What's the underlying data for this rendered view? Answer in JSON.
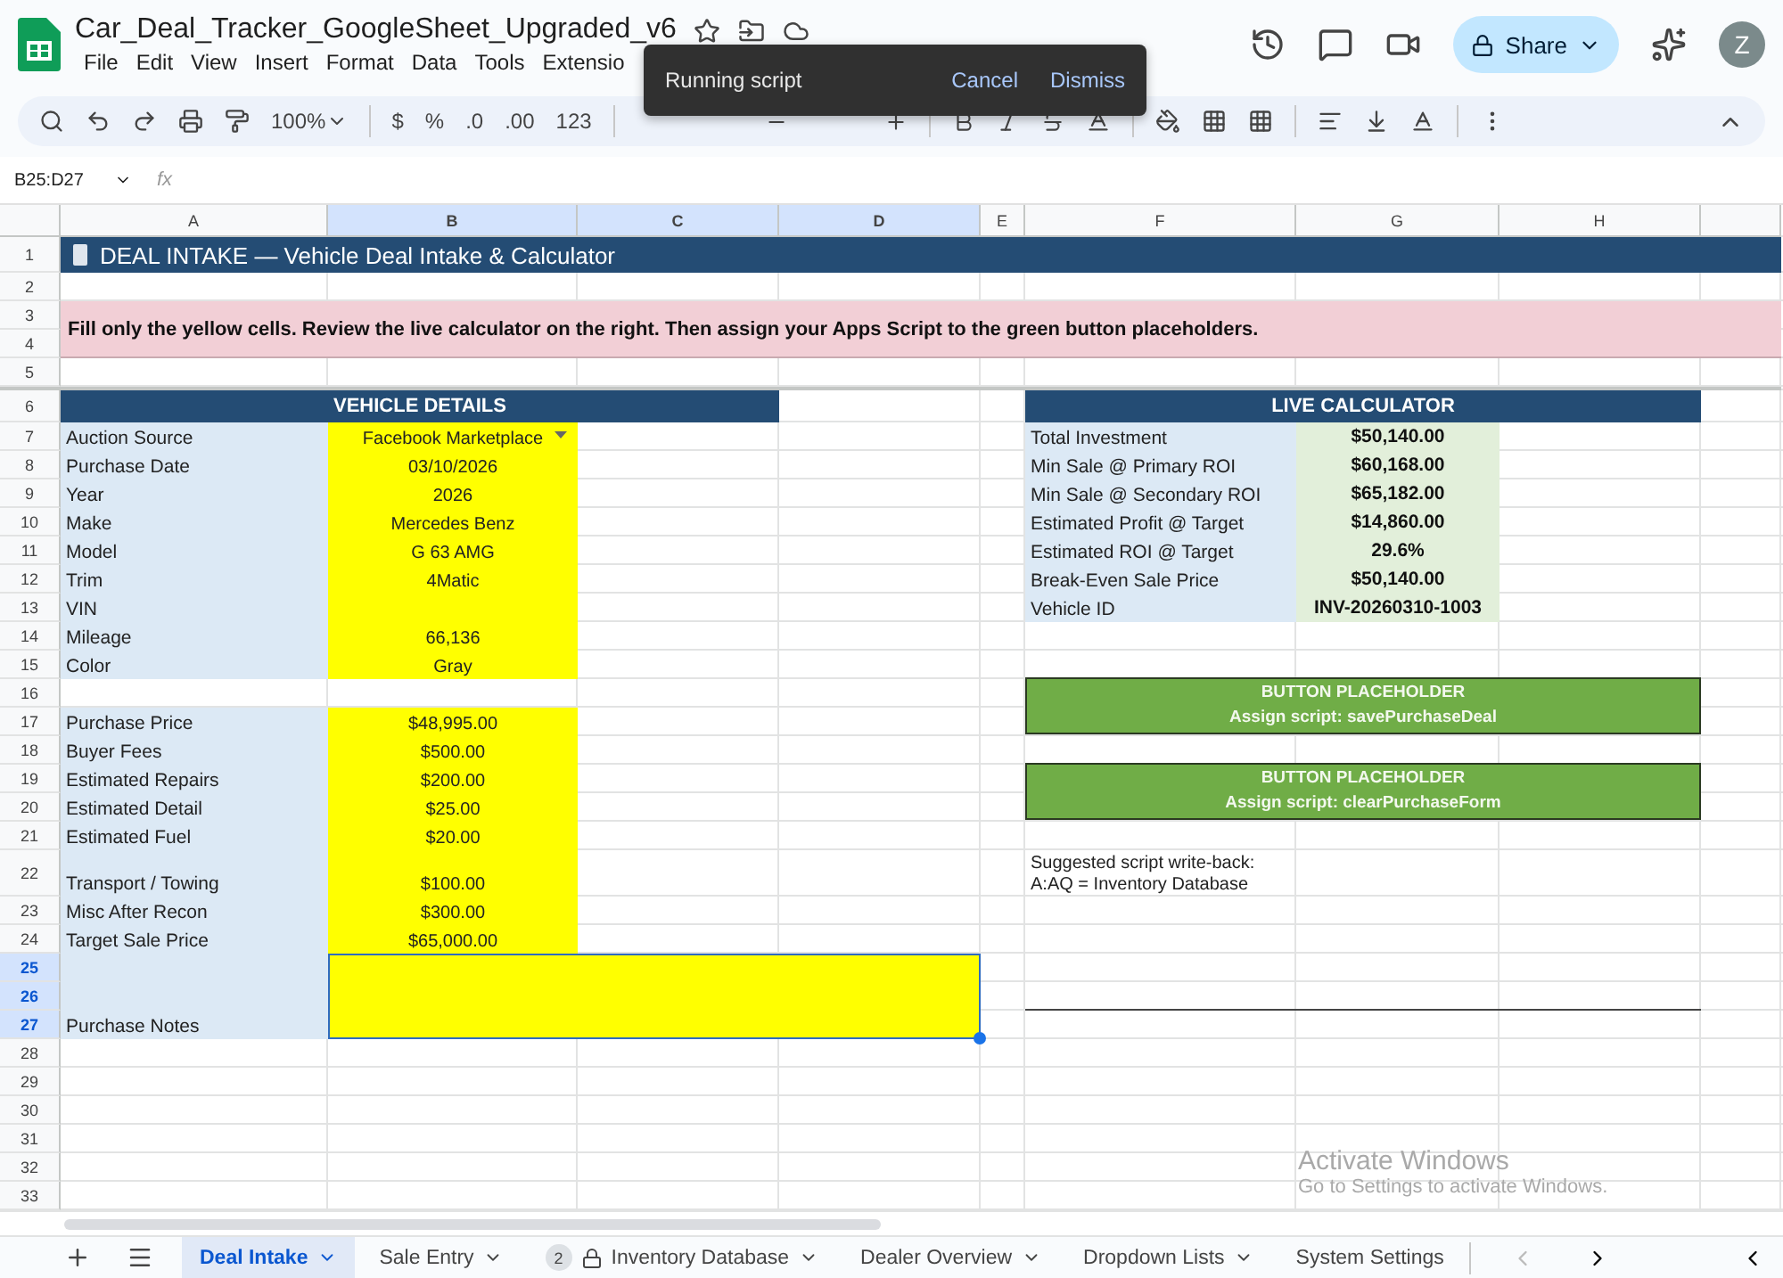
{
  "document": {
    "title": "Car_Deal_Tracker_GoogleSheet_Upgraded_v6",
    "menu": [
      "File",
      "Edit",
      "View",
      "Insert",
      "Format",
      "Data",
      "Tools",
      "Extensio"
    ]
  },
  "toast": {
    "message": "Running script",
    "actions": [
      "Cancel",
      "Dismiss"
    ]
  },
  "header_actions": {
    "share": "Share",
    "avatar": "Z"
  },
  "toolbar": {
    "zoom": "100%",
    "formats": [
      "$",
      "%",
      ".0",
      ".00",
      "123"
    ]
  },
  "formula_bar": {
    "name_box": "B25:D27",
    "fx": "fx"
  },
  "columns": [
    {
      "label": "A",
      "selected": false
    },
    {
      "label": "B",
      "selected": true
    },
    {
      "label": "C",
      "selected": true
    },
    {
      "label": "D",
      "selected": true
    },
    {
      "label": "E",
      "selected": false
    },
    {
      "label": "F",
      "selected": false
    },
    {
      "label": "G",
      "selected": false
    },
    {
      "label": "H",
      "selected": false
    }
  ],
  "rows": [
    {
      "label": "1",
      "selected": false
    },
    {
      "label": "2",
      "selected": false
    },
    {
      "label": "3",
      "selected": false
    },
    {
      "label": "4",
      "selected": false
    },
    {
      "label": "5",
      "selected": false
    },
    {
      "label": "6",
      "selected": false
    },
    {
      "label": "7",
      "selected": false
    },
    {
      "label": "8",
      "selected": false
    },
    {
      "label": "9",
      "selected": false
    },
    {
      "label": "10",
      "selected": false
    },
    {
      "label": "11",
      "selected": false
    },
    {
      "label": "12",
      "selected": false
    },
    {
      "label": "13",
      "selected": false
    },
    {
      "label": "14",
      "selected": false
    },
    {
      "label": "15",
      "selected": false
    },
    {
      "label": "16",
      "selected": false
    },
    {
      "label": "17",
      "selected": false
    },
    {
      "label": "18",
      "selected": false
    },
    {
      "label": "19",
      "selected": false
    },
    {
      "label": "20",
      "selected": false
    },
    {
      "label": "21",
      "selected": false
    },
    {
      "label": "22",
      "selected": false
    },
    {
      "label": "23",
      "selected": false
    },
    {
      "label": "24",
      "selected": false
    },
    {
      "label": "25",
      "selected": true
    },
    {
      "label": "26",
      "selected": true
    },
    {
      "label": "27",
      "selected": true
    },
    {
      "label": "28",
      "selected": false
    },
    {
      "label": "29",
      "selected": false
    },
    {
      "label": "30",
      "selected": false
    },
    {
      "label": "31",
      "selected": false
    },
    {
      "label": "32",
      "selected": false
    },
    {
      "label": "33",
      "selected": false
    }
  ],
  "banner": "DEAL INTAKE — Vehicle Deal Intake & Calculator",
  "instruction": "Fill only the yellow cells. Review the live calculator on the right. Then assign your Apps Script to the green button placeholders.",
  "vehicle_details": {
    "header": "VEHICLE DETAILS",
    "fields": [
      {
        "label": "Auction Source",
        "value": "Facebook Marketplace",
        "kind": "dropdown"
      },
      {
        "label": "Purchase Date",
        "value": "03/10/2026",
        "kind": "text"
      },
      {
        "label": "Year",
        "value": "2026",
        "kind": "text"
      },
      {
        "label": "Make",
        "value": "Mercedes Benz",
        "kind": "text"
      },
      {
        "label": "Model",
        "value": "G 63 AMG",
        "kind": "text"
      },
      {
        "label": "Trim",
        "value": "4Matic",
        "kind": "text"
      },
      {
        "label": "VIN",
        "kind": "text"
      },
      {
        "label": "Mileage",
        "value": "66,136",
        "kind": "text"
      },
      {
        "label": "Color",
        "value": "Gray",
        "kind": "text"
      }
    ]
  },
  "costs": [
    {
      "label": "Purchase Price",
      "value": "$48,995.00"
    },
    {
      "label": "Buyer Fees",
      "value": "$500.00"
    },
    {
      "label": "Estimated Repairs",
      "value": "$200.00"
    },
    {
      "label": "Estimated Detail",
      "value": "$25.00"
    },
    {
      "label": "Estimated Fuel",
      "value": "$20.00"
    },
    {
      "label": "Transport / Towing",
      "value": "$100.00"
    },
    {
      "label": "Misc After Recon",
      "value": "$300.00"
    },
    {
      "label": "Target Sale Price",
      "value": "$65,000.00"
    }
  ],
  "notes": {
    "label": "Purchase Notes"
  },
  "live_calculator": {
    "header": "LIVE CALCULATOR",
    "rows": [
      {
        "label": "Total Investment",
        "value": "$50,140.00"
      },
      {
        "label": "Min Sale @ Primary ROI",
        "value": "$60,168.00"
      },
      {
        "label": "Min Sale @ Secondary ROI",
        "value": "$65,182.00"
      },
      {
        "label": "Estimated Profit @ Target",
        "value": "$14,860.00"
      },
      {
        "label": "Estimated ROI @ Target",
        "value": "29.6%"
      },
      {
        "label": "Break-Even Sale Price",
        "value": "$50,140.00"
      },
      {
        "label": "Vehicle ID",
        "value": "INV-20260310-1003"
      }
    ]
  },
  "button_placeholders": [
    {
      "title": "BUTTON PLACEHOLDER",
      "script": "Assign script: savePurchaseDeal"
    },
    {
      "title": "BUTTON PLACEHOLDER",
      "script": "Assign script: clearPurchaseForm"
    }
  ],
  "write_back_note": [
    "Suggested script write-back:",
    "A:AQ = Inventory Database"
  ],
  "os_notice": {
    "title": "Activate Windows",
    "subtitle": "Go to Settings to activate Windows."
  },
  "sheet_tabs": [
    {
      "label": "Deal Intake",
      "selected": true,
      "locked": false,
      "dropdown": true
    },
    {
      "label": "Sale Entry",
      "selected": false,
      "locked": false,
      "dropdown": true
    },
    {
      "label": "Inventory Database",
      "selected": false,
      "locked": true,
      "badge": "2",
      "dropdown": true
    },
    {
      "label": "Dealer Overview",
      "selected": false,
      "locked": false,
      "dropdown": true
    },
    {
      "label": "Dropdown Lists",
      "selected": false,
      "locked": false,
      "dropdown": true
    },
    {
      "label": "System Settings",
      "selected": false,
      "locked": false,
      "dropdown": false
    }
  ]
}
